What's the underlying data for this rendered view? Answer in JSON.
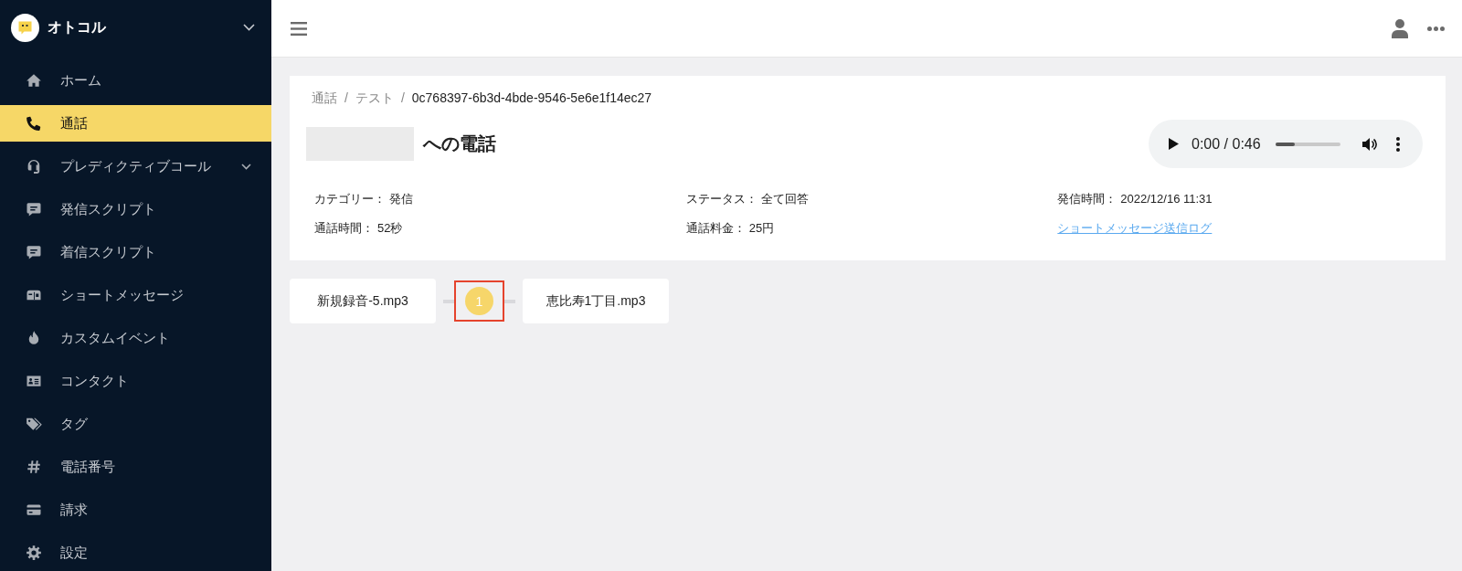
{
  "sidebar": {
    "brand": "オトコル",
    "items": [
      {
        "kind": "link",
        "label": "ホーム",
        "selected": false
      },
      {
        "kind": "link",
        "label": "通話",
        "selected": true
      },
      {
        "kind": "group",
        "label": "プレディクティブコール",
        "selected": false
      },
      {
        "kind": "link",
        "label": "発信スクリプト",
        "selected": false
      },
      {
        "kind": "link",
        "label": "着信スクリプト",
        "selected": false
      },
      {
        "kind": "link",
        "label": "ショートメッセージ",
        "selected": false
      },
      {
        "kind": "link",
        "label": "カスタムイベント",
        "selected": false
      },
      {
        "kind": "link",
        "label": "コンタクト",
        "selected": false
      },
      {
        "kind": "link",
        "label": "タグ",
        "selected": false
      },
      {
        "kind": "link",
        "label": "電話番号",
        "selected": false
      },
      {
        "kind": "link",
        "label": "請求",
        "selected": false
      },
      {
        "kind": "link",
        "label": "設定",
        "selected": false
      }
    ]
  },
  "breadcrumb": [
    {
      "kind": "link",
      "label": "通話"
    },
    {
      "kind": "separator",
      "label": "/"
    },
    {
      "kind": "link",
      "label": "テスト"
    },
    {
      "kind": "separator",
      "label": "/"
    },
    {
      "kind": "current",
      "label": "0c768397-6b3d-4bde-9546-5e6e1f14ec27"
    }
  ],
  "title": {
    "redacted_name": true,
    "text": "への電話"
  },
  "player": {
    "time": "0:00 / 0:46",
    "playing": false,
    "level": 0.3
  },
  "details": [
    {
      "kind": "text",
      "label": "カテゴリー：",
      "value": "発信"
    },
    {
      "kind": "text",
      "label": "ステータス：",
      "value": "全て回答"
    },
    {
      "kind": "text",
      "label": "発信時間：",
      "value": "2022/12/16 11:31"
    },
    {
      "kind": "text",
      "label": "通話時間：",
      "value": "52秒"
    },
    {
      "kind": "text",
      "label": "通話料金：",
      "value": "25円"
    },
    {
      "kind": "link",
      "label": "ショートメッセージ送信ログ"
    }
  ],
  "flow": {
    "nodes": [
      {
        "kind": "file",
        "label": "新規録音-5.mp3",
        "highlighted": false
      },
      {
        "kind": "step",
        "label": "1",
        "highlighted": true
      },
      {
        "kind": "file",
        "label": "恵比寿1丁目.mp3",
        "highlighted": false
      }
    ]
  }
}
